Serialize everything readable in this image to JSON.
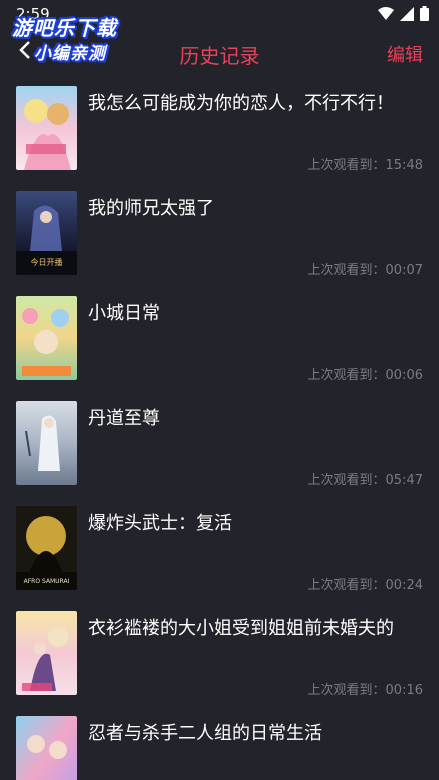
{
  "status": {
    "time": "2:59"
  },
  "watermark": {
    "line1": "游吧乐下载",
    "line2": "小编亲测"
  },
  "header": {
    "title": "历史记录",
    "edit_label": "编辑"
  },
  "history": {
    "time_prefix": "上次观看到：",
    "items": [
      {
        "title": "我怎么可能成为你的恋人，不行不行！",
        "time": "15:48"
      },
      {
        "title": "我的师兄太强了",
        "time": "00:07",
        "poster_text": "今日开播"
      },
      {
        "title": "小城日常",
        "time": "00:06"
      },
      {
        "title": "丹道至尊",
        "time": "05:47"
      },
      {
        "title": "爆炸头武士：复活",
        "time": "00:24",
        "poster_text": "AFRO SAMURAI"
      },
      {
        "title": "衣衫褴褛的大小姐受到姐姐前未婚夫的",
        "time": "00:16"
      },
      {
        "title": "忍者与杀手二人组的日常生活",
        "time": ""
      }
    ]
  },
  "colors": {
    "accent": "#e8425a",
    "background": "#23232b",
    "muted": "#7b7b84"
  }
}
